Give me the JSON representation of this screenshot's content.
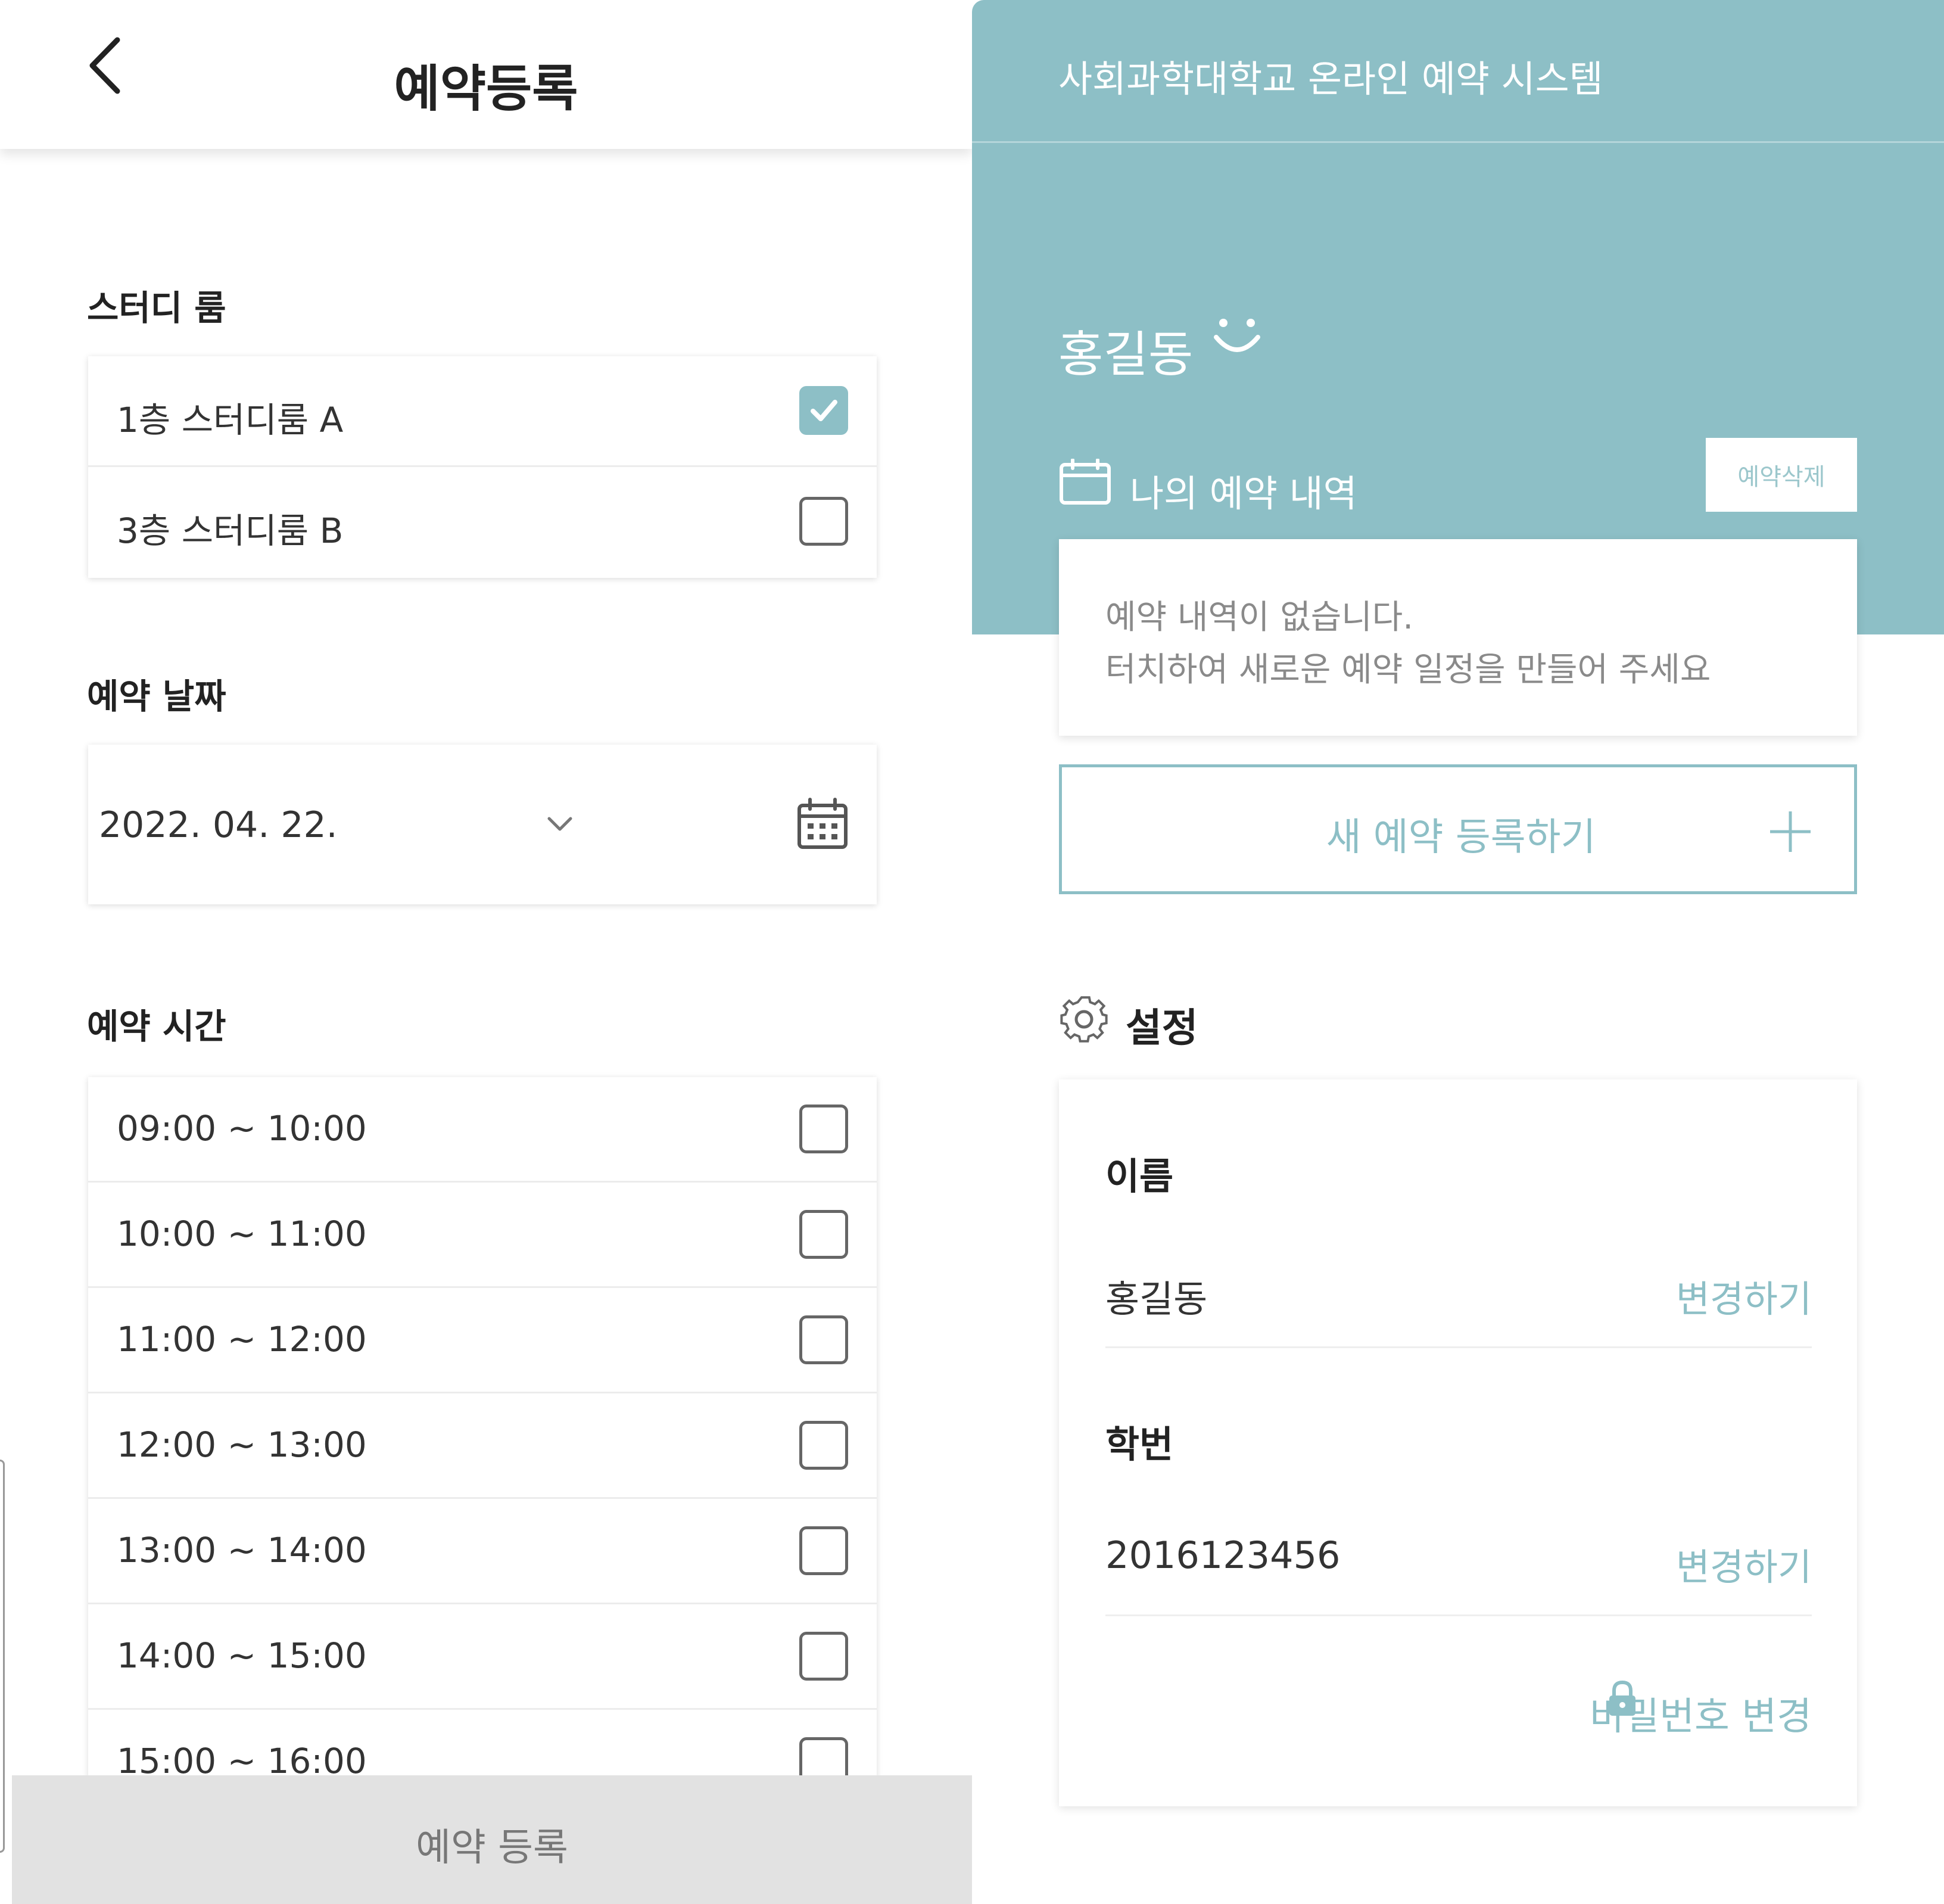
{
  "left_screen": {
    "header": {
      "title": "예약등록"
    },
    "study_room": {
      "label": "스터디 룸",
      "options": [
        {
          "label": "1층 스터디룸 A",
          "checked": true
        },
        {
          "label": "3층 스터디룸 B",
          "checked": false
        }
      ]
    },
    "date": {
      "label": "예약 날짜",
      "value": "2022. 04. 22."
    },
    "time": {
      "label": "예약 시간",
      "slots": [
        {
          "label": "09:00 ~ 10:00",
          "checked": false
        },
        {
          "label": "10:00 ~ 11:00",
          "checked": false
        },
        {
          "label": "11:00 ~ 12:00",
          "checked": false
        },
        {
          "label": "12:00 ~ 13:00",
          "checked": false
        },
        {
          "label": "13:00 ~ 14:00",
          "checked": false
        },
        {
          "label": "14:00 ~ 15:00",
          "checked": false
        },
        {
          "label": "15:00 ~ 16:00",
          "checked": false
        }
      ]
    },
    "submit_label": "예약 등록"
  },
  "right_screen": {
    "app_title": "사회과학대학교 온라인 예약 시스템",
    "user_name": "홍길동",
    "history": {
      "label": "나의 예약 내역",
      "delete_label": "예약삭제",
      "empty_line1": "예약 내역이 없습니다.",
      "empty_line2": "터치하여 새로운 예약 일정을 만들어 주세요"
    },
    "new_reservation_label": "새 예약 등록하기",
    "settings": {
      "label": "설정",
      "name_heading": "이름",
      "name_value": "홍길동",
      "student_id_heading": "학번",
      "student_id_value": "2016123456",
      "change_label": "변경하기",
      "password_change_label": "비밀번호 변경"
    }
  },
  "colors": {
    "accent": "#8dbfc6",
    "submit_bg": "#e2e2e2",
    "text_dark": "#222222",
    "text_muted": "#8a8a8a"
  },
  "icons": [
    "chevron-left-icon",
    "chevron-down-icon",
    "calendar-icon",
    "check-icon",
    "smile-icon",
    "plus-icon",
    "gear-icon",
    "lock-icon"
  ]
}
